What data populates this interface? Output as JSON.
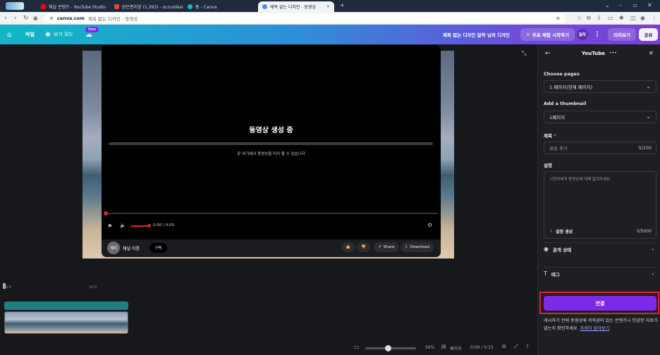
{
  "browser": {
    "tabs": [
      {
        "title": "채널 콘텐츠 - YouTube Studio",
        "color": "#ff0000"
      },
      {
        "title": "받은편지함 (1,393) - ocruxdesig",
        "color": "#ea4335"
      },
      {
        "title": "홈 - Canva",
        "color": "#00c4cc"
      },
      {
        "title": "제목 없는 디자인 - 동영상",
        "color": "#4a8af4",
        "active": true
      }
    ],
    "new_tab": "+",
    "url_domain": "canva.com",
    "url_rest": "제목 없는 디자인 - 동영상"
  },
  "toolbar": {
    "file_label": "파일",
    "view_mode_label": "보기 모드",
    "new_badge": "New",
    "design_title": "제목 없는 디자인 달하 님의 디자인",
    "trial_label": "무료 체험 시작하기",
    "avatar_label": "달하",
    "preview_label": "미리보기",
    "share_label": "공유"
  },
  "video_modal": {
    "heading": "동영상 생성 중",
    "subtext": "곧 여기에서 동영상을 미리 볼 수 있습니다",
    "time": "0:00 / 0:00",
    "channel_avatar": "채이",
    "channel_name": "채널 이름",
    "subscribe": "구독",
    "share": "Share",
    "download": "Download"
  },
  "timeline": {
    "mark_start": "0.8",
    "mark_mid": "10.0",
    "zoom_percent": "56%",
    "pages_label": "페이지",
    "time_readout": "0:00 / 0:15"
  },
  "panel": {
    "title": "YouTube",
    "more": "•••",
    "choose_pages_label": "Choose pages",
    "choose_pages_value": "1 페이지(현재 페이지)",
    "thumbnail_label": "Add a thumbnail",
    "thumbnail_value": "1페이지",
    "title_label": "제목",
    "required_mark": "*",
    "title_placeholder": "제목 추가",
    "title_count": "0/100",
    "description_label": "설명",
    "description_placeholder": "시청자에게 동영상에 대해 알려주세요",
    "generate_label": "설명 생성",
    "description_count": "0/5000",
    "visibility_label": "공개 상태",
    "tags_label": "태그",
    "connect_label": "연결",
    "notice_text": "게시하기 전에 동영상에 저작권이 있는 콘텐츠나 민감한 자료가 없는지 확인하세요.",
    "notice_link": "자세히 알아보기"
  },
  "colors": {
    "accent_purple": "#7d2ae8",
    "highlight_red": "#e0242b",
    "required_red": "#ff5a5a"
  }
}
